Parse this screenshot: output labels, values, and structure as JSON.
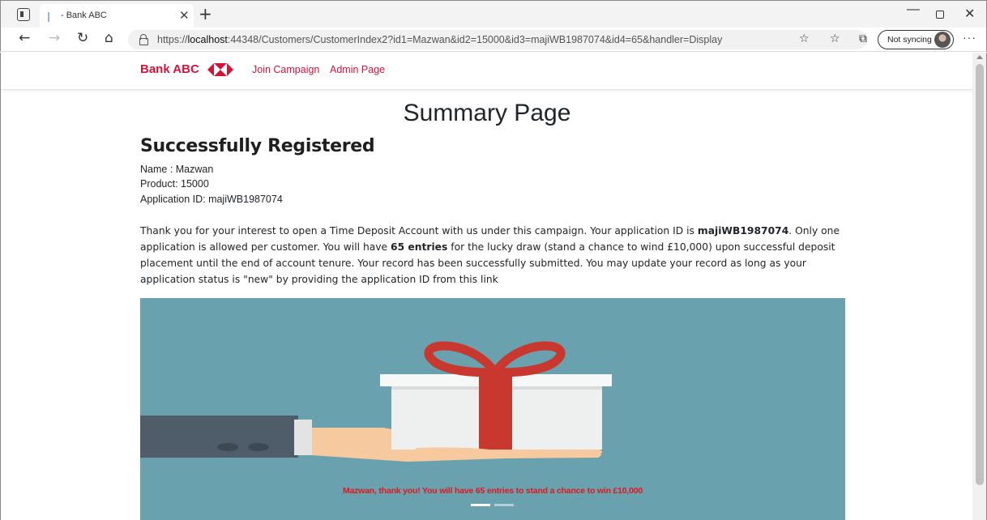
{
  "browser": {
    "tab_title": "- Bank ABC",
    "url_prefix": "https://",
    "url_host": "localhost",
    "url_rest": ":44348/Customers/CustomerIndex2?id1=Mazwan&id2=15000&id3=majiWB1987074&id4=65&handler=Display",
    "sync_label": "Not syncing"
  },
  "site": {
    "brand": "Bank ABC",
    "nav": {
      "join": "Join Campaign",
      "admin": "Admin Page"
    }
  },
  "summary": {
    "page_title": "Summary Page",
    "heading": "Successfully Registered",
    "name_line": "Name : Mazwan",
    "product_line": "Product: 15000",
    "appid_line": "Application ID: majiWB1987074",
    "paragraph": {
      "p1": "Thank you for your interest to open a Time Deposit Account with us under this campaign. Your application ID is ",
      "app_id": "majiWB1987074",
      "p2": ". Only one application is allowed per customer. You will have ",
      "entries": "65 entries",
      "p3": " for the lucky draw (stand a chance to wind £10,000) upon successful deposit placement until the end of account tenure. Your record has been successfully submitted. You may update your record as long as your application status is \"new\" by providing the application ID from this link"
    }
  },
  "carousel": {
    "caption": "Mazwan, thank you! You will have 65 entries to stand a chance to win £10,000",
    "slides": 2,
    "active_slide": 1
  },
  "colors": {
    "brand_red": "#d1133a",
    "carousel_bg": "#69a1ae",
    "caption_red": "#e0181c"
  }
}
